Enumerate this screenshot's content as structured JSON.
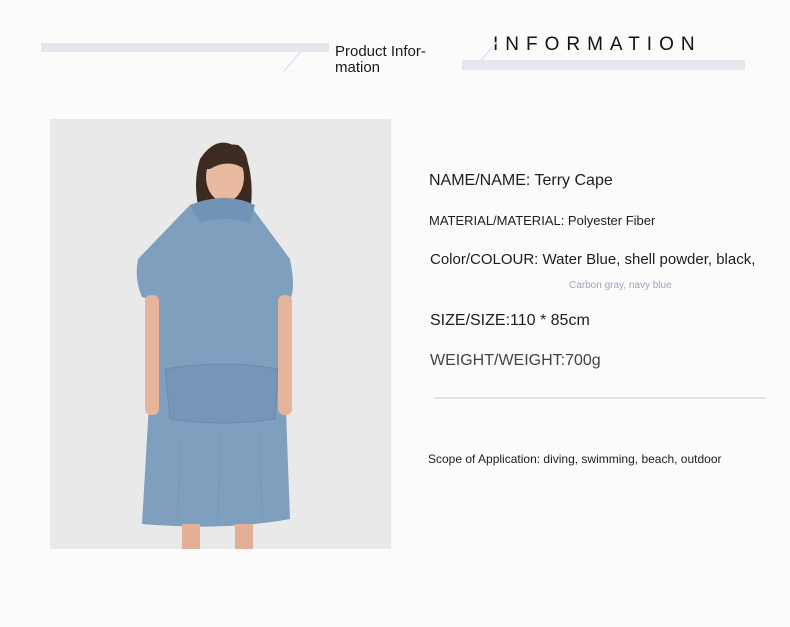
{
  "header": {
    "label": "Product Infor- mation",
    "title": "INFORMATION"
  },
  "product_image": {
    "description_icon": "woman-wearing-hooded-towel-poncho",
    "garment_color": "#7f9fbf",
    "background_color": "#e9e9ea"
  },
  "info": {
    "name": "NAME/NAME: Terry Cape",
    "material": "MATERIAL/MATERIAL: Polyester Fiber",
    "color": "Color/COLOUR: Water Blue, shell powder, black,",
    "color_more": "Carbon gray, navy blue",
    "size": "SIZE/SIZE:110 * 85cm",
    "weight": "WEIGHT/WEIGHT:700g",
    "scope": "Scope of Application: diving, swimming, beach, outdoor"
  }
}
